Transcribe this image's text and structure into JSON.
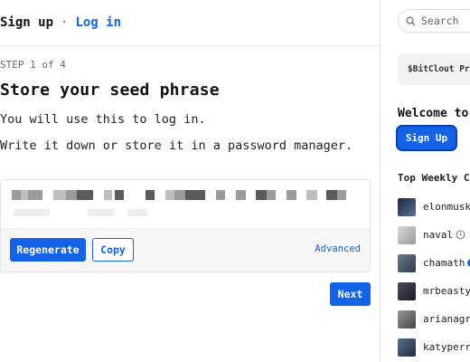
{
  "nav": {
    "signup": "Sign up",
    "separator": "·",
    "login": "Log in"
  },
  "step": "STEP 1 of 4",
  "title": "Store your seed phrase",
  "line1": "You will use this to log in.",
  "line2": "Write it down or store it in a password manager.",
  "buttons": {
    "regenerate": "Regenerate",
    "copy": "Copy",
    "advanced": "Advanced",
    "next": "Next"
  },
  "sidebar": {
    "search_placeholder": "Search",
    "promo": "$BitClout Pri",
    "welcome": "Welcome to",
    "signup": "Sign Up",
    "top_weekly": "Top Weekly Cr",
    "creators": [
      {
        "name": "elonmusk",
        "avatar_color": "#2b3b55"
      },
      {
        "name": "naval",
        "avatar_color": "#b9b9b9"
      },
      {
        "name": "chamath",
        "avatar_color": "#4a5a70"
      },
      {
        "name": "mrbeasty",
        "avatar_color": "#2d2d3a"
      },
      {
        "name": "arianagr",
        "avatar_color": "#6a6a6a"
      },
      {
        "name": "katyperr",
        "avatar_color": "#3c5068"
      }
    ]
  },
  "colors": {
    "primary": "#1463e6"
  }
}
